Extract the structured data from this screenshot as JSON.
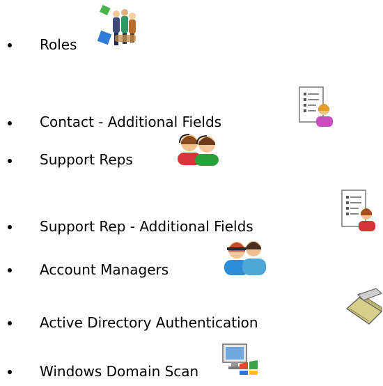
{
  "items": [
    {
      "label": "Roles",
      "icon": "roles-icon"
    },
    {
      "label": "Contact - Additional Fields",
      "icon": "contact-additional-fields-icon"
    },
    {
      "label": "Support Reps",
      "icon": "support-reps-icon"
    },
    {
      "label": "Support Rep - Additional Fields",
      "icon": "support-rep-additional-fields-icon"
    },
    {
      "label": "Account Managers",
      "icon": "account-managers-icon"
    },
    {
      "label": "Active Directory Authentication",
      "icon": "active-directory-authentication-icon"
    },
    {
      "label": "Windows Domain Scan",
      "icon": "windows-domain-scan-icon"
    }
  ]
}
